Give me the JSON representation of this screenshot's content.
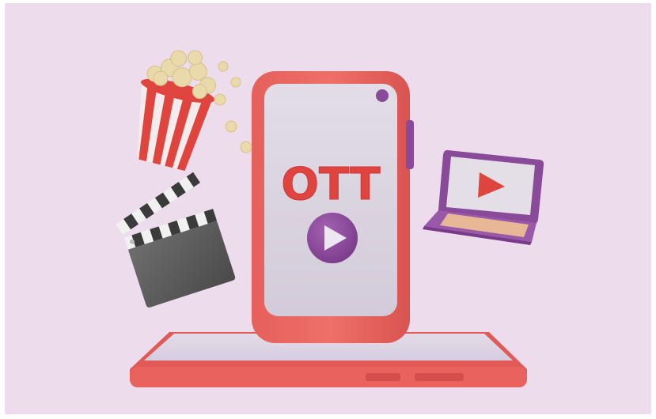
{
  "scene": {
    "title_text": "OTT",
    "colors": {
      "background": "#eddcec",
      "phone_body": "#e8625e",
      "phone_screen": "#dcd6e0",
      "accent_purple": "#8a4a9a",
      "popcorn": "#e9d7a6",
      "bucket_red": "#e0443e",
      "clapper_gray": "#5f5f5f"
    },
    "objects": [
      "smartphone-with-ott-text",
      "play-button-icon",
      "popcorn-bucket",
      "film-clapperboard",
      "laptop-with-play-icon",
      "phone-stand-base"
    ]
  }
}
